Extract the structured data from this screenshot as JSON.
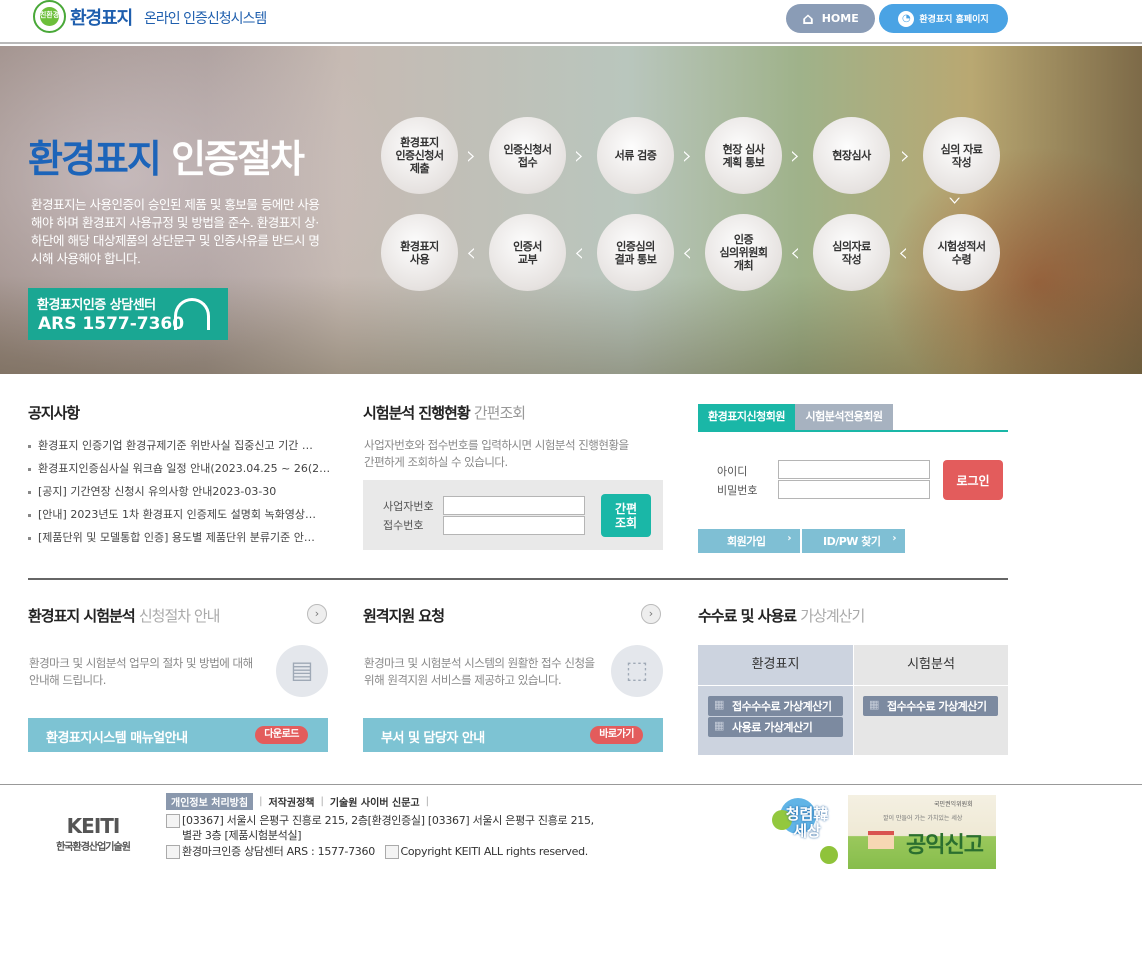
{
  "header": {
    "logo_mark_text": "친환경",
    "logo_title": "환경표지",
    "logo_sub": "온라인 인증신청시스템",
    "home_label": "HOME",
    "homepage_label": "환경표지 홈페이지"
  },
  "banner": {
    "title_part1": "환경표지",
    "title_part2": "인증절차",
    "description": "환경표지는 사용인증이 승인된 제품 및 홍보물 등에만 사용해야 하며 환경표지 사용규정 및 방법을 준수. 환경표지 상·하단에 해당 대상제품의 상단문구 및 인증사유를 반드시 명시해 사용해야 합니다.",
    "consult_title": "환경표지인증 상담센터",
    "consult_phone": "ARS 1577-7360",
    "steps": [
      "환경표지\n인증신청서\n제출",
      "인증신청서\n접수",
      "서류 검증",
      "현장 심사\n계획 통보",
      "현장심사",
      "심의 자료\n작성",
      "시험성적서\n수령",
      "심의자료\n작성",
      "인증\n심의위원회\n개최",
      "인증심의\n결과 통보",
      "인증서\n교부",
      "환경표지\n사용"
    ]
  },
  "notice": {
    "title": "공지사항",
    "items": [
      "환경표지 인증기업 환경규제기준 위반사실 집중신고 기간 …",
      "환경표지인증심사실 워크숍 일정 안내(2023.04.25 ~ 26(2…",
      "[공지] 기간연장 신청시 유의사항 안내2023-03-30",
      "[안내] 2023년도 1차 환경표지 인증제도 설명회 녹화영상…",
      "[제품단위 및 모델통합 인증] 용도별 제품단위 분류기준 안…"
    ]
  },
  "progress": {
    "title": "시험분석 진행현황",
    "title_sub": "간편조회",
    "description_line1": "사업자번호와 접수번호를 입력하시면 시험분석 진행현황을",
    "description_line2": "간편하게 조회하실 수 있습니다.",
    "business_no_label": "사업자번호",
    "receipt_no_label": "접수번호",
    "business_no_value": "",
    "receipt_no_value": "",
    "quick_button": "간편\n조회"
  },
  "login": {
    "tab_member": "환경표지신청회원",
    "tab_lab": "시험분석전용회원",
    "id_label": "아이디",
    "pw_label": "비밀번호",
    "id_value": "",
    "pw_value": "",
    "login_button": "로그인",
    "join_button": "회원가입",
    "find_button": "ID/PW 찾기"
  },
  "guide": {
    "title": "환경표지 시험분석",
    "title_sub": "신청절차 안내",
    "description_line1": "환경마크 및 시험분석 업무의 절차 및 방법에 대해",
    "description_line2": "안내해 드립니다.",
    "bar_label": "환경표지시스템 매뉴얼안내",
    "bar_pill": "다운로드"
  },
  "remote": {
    "title": "원격지원 요청",
    "description_line1": "환경마크 및 시험분석 시스템의 원활한 접수 신청을",
    "description_line2": "위해 원격지원 서비스를 제공하고 있습니다.",
    "bar_label": "부서 및 담당자 안내",
    "bar_pill": "바로가기"
  },
  "calculator": {
    "title": "수수료 및 사용료",
    "title_sub": "가상계산기",
    "col1": "환경표지",
    "col2": "시험분석",
    "col1_btn1": "접수수수료 가상계산기",
    "col1_btn2": "사용료 가상계산기",
    "col2_btn1": "접수수수료 가상계산기"
  },
  "footer": {
    "org_short": "KEITI",
    "org_name": "한국환경산업기술원",
    "link_privacy": "개인정보 처리방침",
    "link_copyright": "저작권정책",
    "link_cyber": "기술원 사이버 신문고",
    "address_line1": "[03367] 서울시 은평구 진흥로 215, 2층[환경인증실] [03367] 서울시 은평구 진흥로 215,",
    "address_line2": "별관 3층 [제품시험분석실]",
    "contact": "환경마크인증 상담센터 ARS : 1577-7360",
    "copyright": "Copyright KEITI ALL rights reserved.",
    "clean_logo_text": "청렴韓\n세상",
    "report_small": "국민권익위원회",
    "report_tagline": "깔이 만들어 가는 가치있는 세상",
    "report_big": "공익신고"
  },
  "colors": {
    "brand_blue": "#1f5fae",
    "teal": "#1ab7a7",
    "red_button": "#e35c5c",
    "light_blue_bar": "#7dc3d3"
  }
}
